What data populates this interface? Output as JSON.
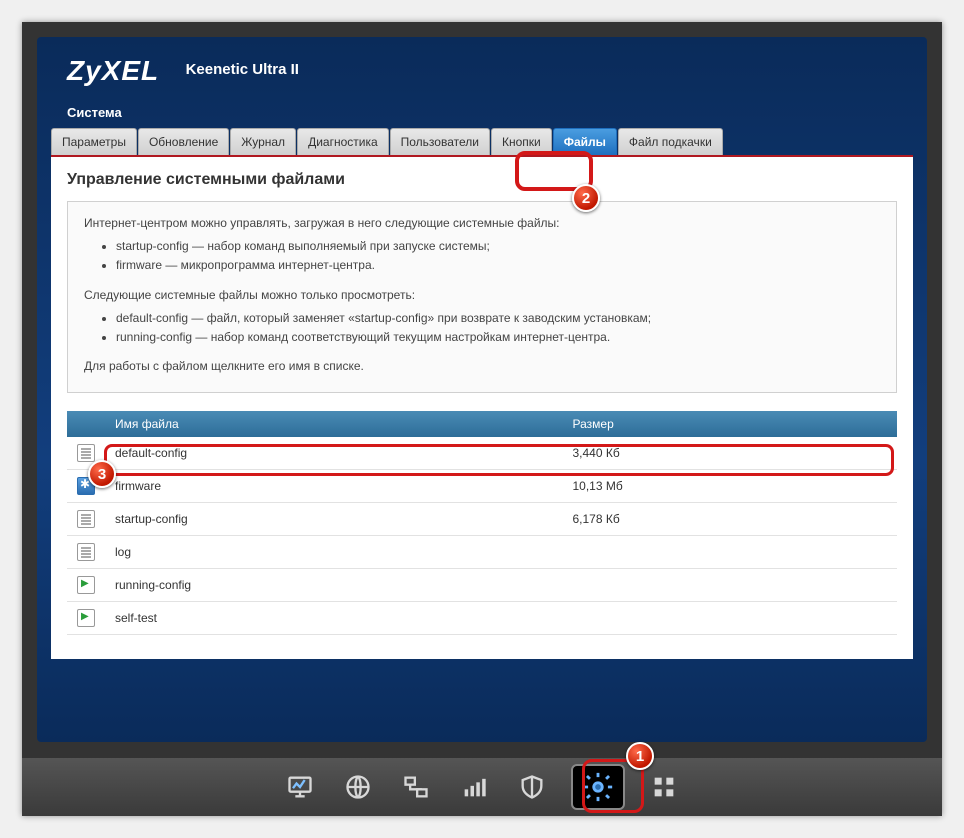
{
  "brand": "ZyXEL",
  "model": "Keenetic Ultra II",
  "section": "Система",
  "tabs": [
    {
      "label": "Параметры"
    },
    {
      "label": "Обновление"
    },
    {
      "label": "Журнал"
    },
    {
      "label": "Диагностика"
    },
    {
      "label": "Пользователи"
    },
    {
      "label": "Кнопки"
    },
    {
      "label": "Файлы",
      "active": true
    },
    {
      "label": "Файл подкачки"
    }
  ],
  "page_heading": "Управление системными файлами",
  "info": {
    "p1": "Интернет-центром можно управлять, загружая в него следующие системные файлы:",
    "list1": [
      "startup-config — набор команд выполняемый при запуске системы;",
      "firmware — микропрограмма интернет-центра."
    ],
    "p2": "Следующие системные файлы можно только просмотреть:",
    "list2": [
      "default-config — файл, который заменяет «startup-config» при возврате к заводским установкам;",
      "running-config — набор команд соответствующий текущим настройкам интернет-центра."
    ],
    "p3": "Для работы с файлом щелкните его имя в списке."
  },
  "table": {
    "col_name": "Имя файла",
    "col_size": "Размер",
    "rows": [
      {
        "icon": "doc",
        "name": "default-config",
        "size": "3,440 Кб"
      },
      {
        "icon": "gear",
        "name": "firmware",
        "size": "10,13 Мб"
      },
      {
        "icon": "doc",
        "name": "startup-config",
        "size": "6,178 Кб"
      },
      {
        "icon": "doc",
        "name": "log",
        "size": ""
      },
      {
        "icon": "run",
        "name": "running-config",
        "size": ""
      },
      {
        "icon": "run",
        "name": "self-test",
        "size": ""
      }
    ]
  },
  "markers": {
    "m1": "1",
    "m2": "2",
    "m3": "3"
  },
  "dock": [
    {
      "name": "monitor-icon"
    },
    {
      "name": "globe-icon"
    },
    {
      "name": "network-icon"
    },
    {
      "name": "wifi-icon"
    },
    {
      "name": "shield-icon"
    },
    {
      "name": "gear-icon",
      "selected": true
    },
    {
      "name": "apps-icon"
    }
  ]
}
